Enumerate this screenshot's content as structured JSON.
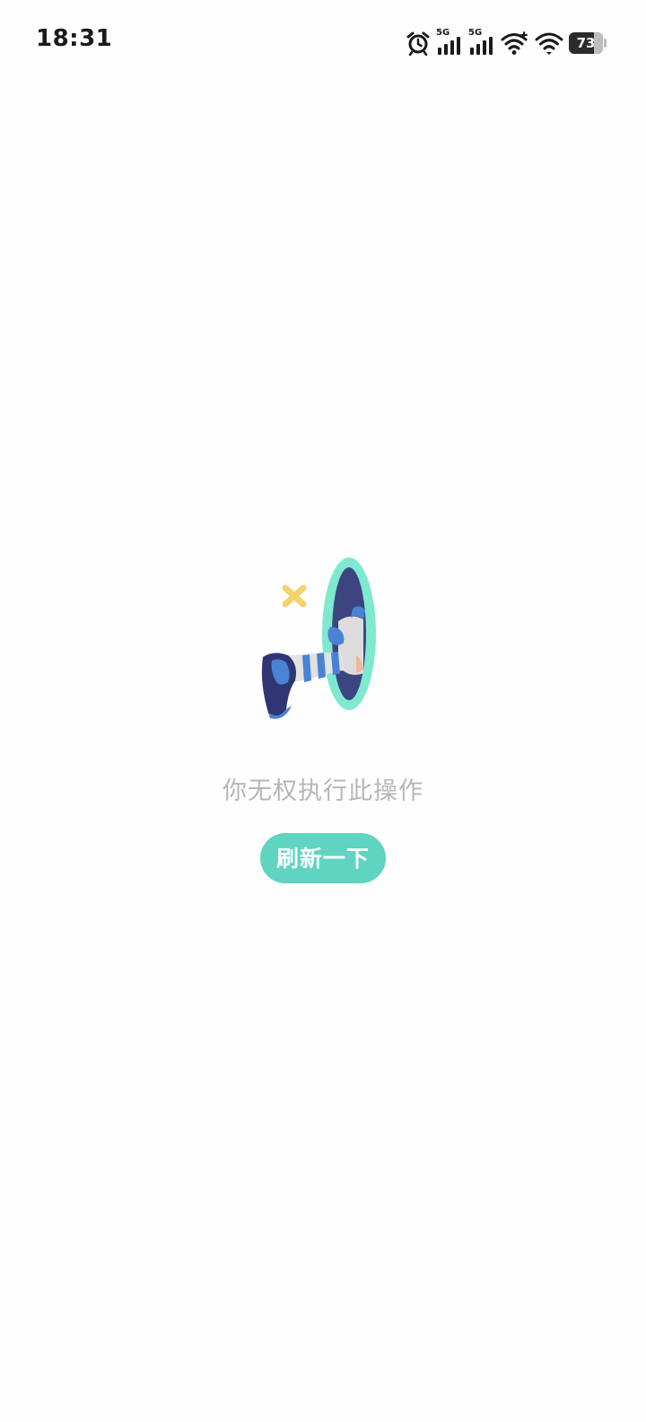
{
  "status_bar": {
    "time": "18:31",
    "signal_1_label": "5G",
    "signal_2_label": "5G",
    "battery_level": 73,
    "battery_text": "73",
    "icons": [
      "alarm-icon",
      "signal-5g-icon",
      "signal-5g-icon",
      "wifi-plus-icon",
      "wifi-icon",
      "battery-icon"
    ]
  },
  "empty_state": {
    "illustration": "portal-character-illustration",
    "message": "你无权执行此操作",
    "refresh_label": "刷新一下"
  },
  "colors": {
    "accent": "#5fd4c0",
    "message_text": "#b4b6bc",
    "portal_rim": "#7fe9cf",
    "portal_inside": "#3d4580",
    "sparkle": "#f3d36b",
    "character_blue": "#4a82d6"
  }
}
